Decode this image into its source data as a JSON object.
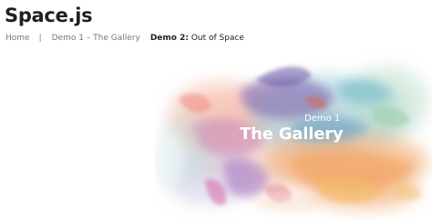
{
  "site": {
    "title": "Space.js"
  },
  "nav": {
    "home": "Home",
    "separator": "|",
    "demo1": "Demo 1 – The Gallery",
    "current_prefix": "Demo 2:",
    "current_rest": " Out of Space"
  },
  "hero": {
    "kicker": "Demo 1",
    "title": "The Gallery"
  },
  "colors": {
    "title_text": "#1f1f1f",
    "nav_text": "#777777",
    "current_text": "#222222",
    "hero_text": "#ffffff"
  }
}
